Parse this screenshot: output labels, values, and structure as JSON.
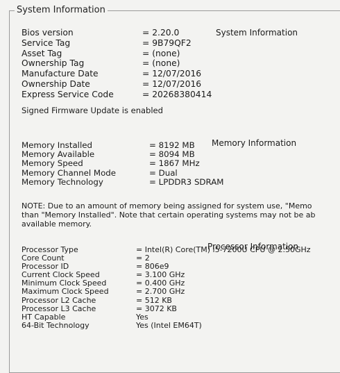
{
  "group_title": "System Information",
  "system": {
    "heading": "System Information",
    "rows": [
      {
        "label": "Bios version",
        "value": "= 2.20.0"
      },
      {
        "label": "Service Tag",
        "value": "= 9B79QF2"
      },
      {
        "label": "Asset Tag",
        "value": "= (none)"
      },
      {
        "label": "Ownership Tag",
        "value": "= (none)"
      },
      {
        "label": "Manufacture Date",
        "value": "= 12/07/2016"
      },
      {
        "label": "Ownership Date",
        "value": "= 12/07/2016"
      },
      {
        "label": "Express Service Code",
        "value": "= 20268380414"
      }
    ],
    "firmware_message": "Signed Firmware Update is enabled"
  },
  "memory": {
    "heading": "Memory Information",
    "rows": [
      {
        "label": "Memory Installed",
        "value": "= 8192 MB"
      },
      {
        "label": "Memory Available",
        "value": "= 8094 MB"
      },
      {
        "label": "Memory Speed",
        "value": "= 1867 MHz"
      },
      {
        "label": "Memory Channel Mode",
        "value": "= Dual"
      },
      {
        "label": "Memory Technology",
        "value": "= LPDDR3 SDRAM"
      }
    ],
    "note_lines": [
      "NOTE: Due to an amount of memory being assigned for system use, \"Memo",
      "than \"Memory Installed\". Note that certain operating systems may not be ab",
      "available memory."
    ]
  },
  "processor": {
    "heading": "Processor Information",
    "rows": [
      {
        "label": "Processor Type",
        "value": "= Intel(R) Core(TM) i5-7200U CPU @ 2.50GHz"
      },
      {
        "label": "Core Count",
        "value": "= 2"
      },
      {
        "label": "Processor ID",
        "value": "= 806e9"
      },
      {
        "label": "Current Clock Speed",
        "value": "= 3.100 GHz"
      },
      {
        "label": "Minimum Clock Speed",
        "value": "= 0.400 GHz"
      },
      {
        "label": "Maximum Clock Speed",
        "value": "= 2.700 GHz"
      },
      {
        "label": "Processor L2 Cache",
        "value": "= 512 KB"
      },
      {
        "label": "Processor L3 Cache",
        "value": "= 3072 KB"
      },
      {
        "label": "HT Capable",
        "value": "Yes"
      },
      {
        "label": "64-Bit Technology",
        "value": "Yes (Intel EM64T)"
      }
    ]
  }
}
